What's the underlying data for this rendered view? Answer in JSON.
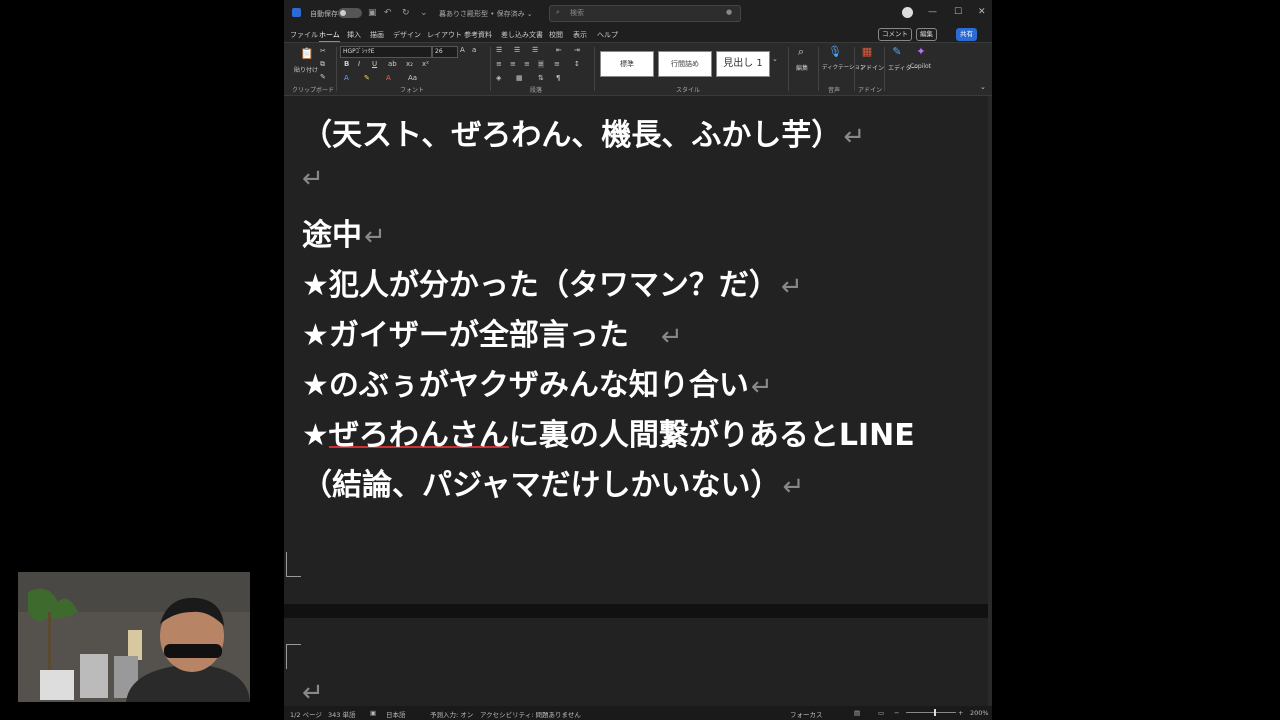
{
  "window": {
    "autosave_label": "自動保存",
    "autosave_state": "オフ",
    "doc_title": "暮ありさ殿形型 • 保存済み ⌄",
    "search_placeholder": "検索",
    "minimize": "—",
    "maximize": "☐",
    "close": "✕"
  },
  "tabs": [
    "ファイル",
    "ホーム",
    "挿入",
    "描画",
    "デザイン",
    "レイアウト",
    "参考資料",
    "差し込み文書",
    "校閲",
    "表示",
    "ヘルプ"
  ],
  "active_tab": "ホーム",
  "top_buttons": {
    "comment": "コメント",
    "edit": "編集",
    "share": "共有"
  },
  "ribbon": {
    "groups": [
      "クリップボード",
      "フォント",
      "段落",
      "スタイル",
      "音声",
      "アドイン"
    ],
    "paste_label": "貼り付け",
    "font_name": "HGPｺﾞｼｯｸE",
    "font_size": "26",
    "styles": [
      "標準",
      "行間詰め",
      "見出し 1"
    ],
    "edit_label": "編集",
    "dictate_label": "ディクテーション",
    "addin_label": "アドイン",
    "editor_label": "エディター",
    "copilot_label": "Copilot"
  },
  "document": {
    "lines": [
      {
        "text": "（天スト、ぜろわん、機長、ふかし芋）",
        "mark": "↵"
      },
      {
        "text": "",
        "mark": "↵"
      },
      {
        "text": "途中",
        "mark": "↵"
      },
      {
        "text": "★犯人が分かった（タワマン？だ）",
        "mark": "↵"
      },
      {
        "text": "★ガイザーが全部言った　",
        "mark": "↵"
      },
      {
        "text": "★のぶぅがヤクザみんな知り合い",
        "mark": "↵"
      },
      {
        "prefix": "★",
        "underlined": "ぜろわんさん",
        "rest": "に裏の人間繋がりあるとLINE",
        "mark": ""
      },
      {
        "text": "（結論、パジャマだけしかいない）",
        "mark": "↵"
      }
    ],
    "page2_mark": "↵"
  },
  "status": {
    "page": "1/2 ページ",
    "words": "343 単語",
    "language": "日本語",
    "predict": "予測入力: オン",
    "accessibility": "アクセシビリティ: 問題ありません",
    "focus": "フォーカス",
    "zoom": "200%"
  }
}
